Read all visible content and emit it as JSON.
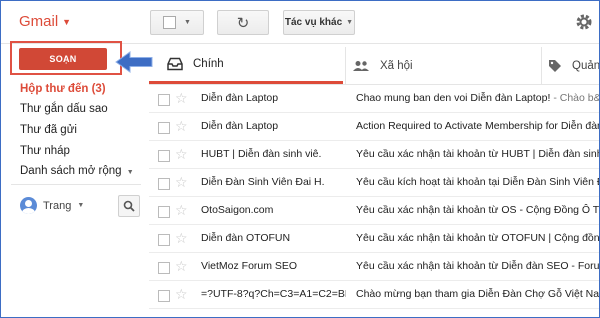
{
  "app": {
    "title": "Gmail"
  },
  "toolbar": {
    "refresh_icon": "↻",
    "more_label": "Tác vụ khác"
  },
  "compose": {
    "label": "SOẠN"
  },
  "nav": [
    {
      "label": "Hộp thư đến (3)",
      "active": true
    },
    {
      "label": "Thư gắn dấu sao"
    },
    {
      "label": "Thư đã gửi"
    },
    {
      "label": "Thư nháp"
    },
    {
      "label": "Danh sách mở rộng"
    }
  ],
  "user": {
    "name": "Trang"
  },
  "tabs": [
    {
      "label": "Chính",
      "icon": "inbox-icon"
    },
    {
      "label": "Xã hội",
      "icon": "people-icon"
    },
    {
      "label": "Quảng",
      "icon": "tag-icon"
    }
  ],
  "emails": [
    {
      "sender": "Diễn đàn Laptop",
      "subject": "Chao mung ban den voi Diễn đàn Laptop!",
      "snippet": " - Chào b&#78"
    },
    {
      "sender": "Diễn đàn Laptop",
      "subject": "Action Required to Activate Membership for Diễn đàn La",
      "snippet": ""
    },
    {
      "sender": "HUBT | Diễn đàn sinh viê.",
      "subject": "Yêu cầu xác nhận tài khoản từ HUBT | Diễn đàn sinh viê",
      "snippet": ""
    },
    {
      "sender": "Diễn Đàn Sinh Viên Đai H.",
      "subject": "Yêu cầu kích hoạt tài khoản tại Diễn Đàn Sinh Viên Đai",
      "snippet": ""
    },
    {
      "sender": "OtoSaigon.com",
      "subject": "Yêu cầu xác nhận tài khoản từ OS - Cộng Đồng Ô Tô V",
      "snippet": ""
    },
    {
      "sender": "Diễn đàn OTOFUN",
      "subject": "Yêu cầu xác nhận tài khoản từ OTOFUN | Cộng đồng O",
      "snippet": ""
    },
    {
      "sender": "VietMoz Forum SEO",
      "subject": "Yêu cầu xác nhận tài khoản từ Diễn đàn SEO - Forum S",
      "snippet": ""
    },
    {
      "sender": "=?UTF-8?q?Ch=C3=A1=C2=BB.",
      "subject": "Chào mừng bạn tham gia Diễn Đàn Chợ Gỗ Việt Nam !",
      "snippet": ""
    }
  ],
  "colors": {
    "accent": "#dd4b39",
    "compose": "#d14836",
    "arrow": "#3d6dc4"
  }
}
